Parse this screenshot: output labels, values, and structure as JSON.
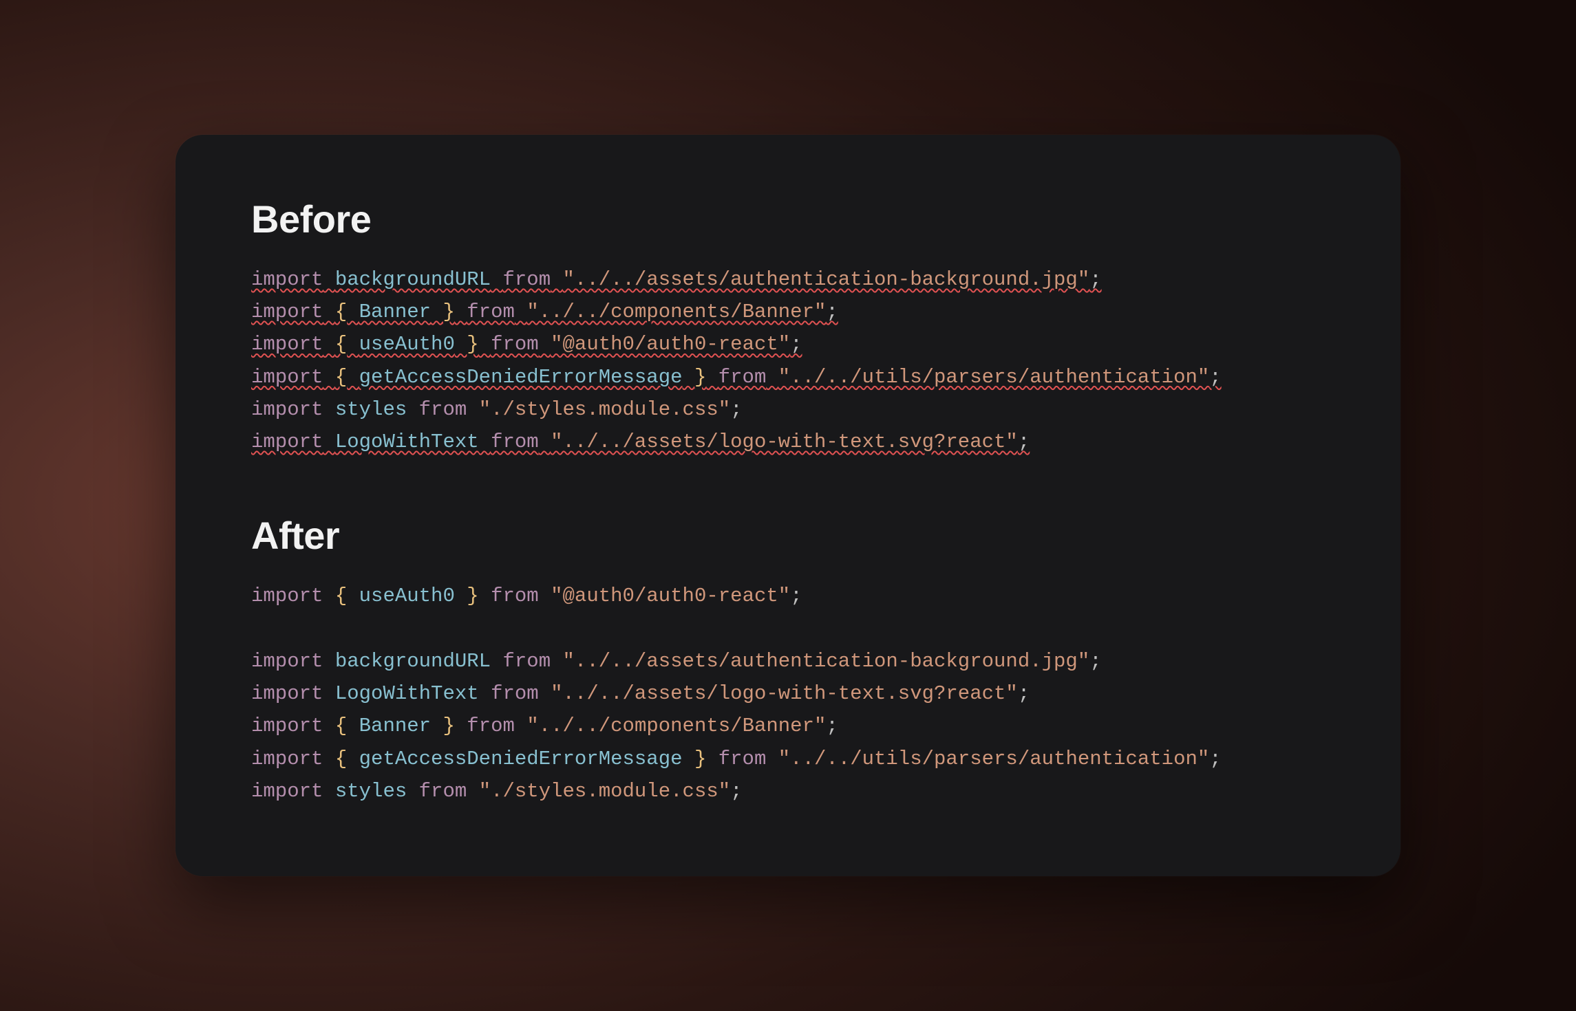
{
  "before": {
    "heading": "Before",
    "lines": [
      {
        "error": true,
        "tokens": [
          {
            "cls": "tok-kw",
            "text": "import"
          },
          {
            "cls": "tok-plain",
            "text": " "
          },
          {
            "cls": "tok-ident",
            "text": "backgroundURL"
          },
          {
            "cls": "tok-plain",
            "text": " "
          },
          {
            "cls": "tok-kw",
            "text": "from"
          },
          {
            "cls": "tok-plain",
            "text": " "
          },
          {
            "cls": "tok-str",
            "text": "\"../../assets/authentication-background.jpg\""
          },
          {
            "cls": "tok-plain",
            "text": ";"
          }
        ]
      },
      {
        "error": true,
        "tokens": [
          {
            "cls": "tok-kw",
            "text": "import"
          },
          {
            "cls": "tok-plain",
            "text": " "
          },
          {
            "cls": "tok-brace",
            "text": "{"
          },
          {
            "cls": "tok-plain",
            "text": " "
          },
          {
            "cls": "tok-ident",
            "text": "Banner"
          },
          {
            "cls": "tok-plain",
            "text": " "
          },
          {
            "cls": "tok-brace",
            "text": "}"
          },
          {
            "cls": "tok-plain",
            "text": " "
          },
          {
            "cls": "tok-kw",
            "text": "from"
          },
          {
            "cls": "tok-plain",
            "text": " "
          },
          {
            "cls": "tok-str",
            "text": "\"../../components/Banner\""
          },
          {
            "cls": "tok-plain",
            "text": ";"
          }
        ]
      },
      {
        "error": true,
        "tokens": [
          {
            "cls": "tok-kw",
            "text": "import"
          },
          {
            "cls": "tok-plain",
            "text": " "
          },
          {
            "cls": "tok-brace",
            "text": "{"
          },
          {
            "cls": "tok-plain",
            "text": " "
          },
          {
            "cls": "tok-ident",
            "text": "useAuth0"
          },
          {
            "cls": "tok-plain",
            "text": " "
          },
          {
            "cls": "tok-brace",
            "text": "}"
          },
          {
            "cls": "tok-plain",
            "text": " "
          },
          {
            "cls": "tok-kw",
            "text": "from"
          },
          {
            "cls": "tok-plain",
            "text": " "
          },
          {
            "cls": "tok-str",
            "text": "\"@auth0/auth0-react\""
          },
          {
            "cls": "tok-plain",
            "text": ";"
          }
        ]
      },
      {
        "error": true,
        "tokens": [
          {
            "cls": "tok-kw",
            "text": "import"
          },
          {
            "cls": "tok-plain",
            "text": " "
          },
          {
            "cls": "tok-brace",
            "text": "{"
          },
          {
            "cls": "tok-plain",
            "text": " "
          },
          {
            "cls": "tok-ident",
            "text": "getAccessDeniedErrorMessage"
          },
          {
            "cls": "tok-plain",
            "text": " "
          },
          {
            "cls": "tok-brace",
            "text": "}"
          },
          {
            "cls": "tok-plain",
            "text": " "
          },
          {
            "cls": "tok-kw",
            "text": "from"
          },
          {
            "cls": "tok-plain",
            "text": " "
          },
          {
            "cls": "tok-str",
            "text": "\"../../utils/parsers/authentication\""
          },
          {
            "cls": "tok-plain",
            "text": ";"
          }
        ]
      },
      {
        "error": false,
        "tokens": [
          {
            "cls": "tok-kw",
            "text": "import"
          },
          {
            "cls": "tok-plain",
            "text": " "
          },
          {
            "cls": "tok-ident",
            "text": "styles"
          },
          {
            "cls": "tok-plain",
            "text": " "
          },
          {
            "cls": "tok-kw",
            "text": "from"
          },
          {
            "cls": "tok-plain",
            "text": " "
          },
          {
            "cls": "tok-str",
            "text": "\"./styles.module.css\""
          },
          {
            "cls": "tok-plain",
            "text": ";"
          }
        ]
      },
      {
        "error": true,
        "tokens": [
          {
            "cls": "tok-kw",
            "text": "import"
          },
          {
            "cls": "tok-plain",
            "text": " "
          },
          {
            "cls": "tok-ident",
            "text": "LogoWithText"
          },
          {
            "cls": "tok-plain",
            "text": " "
          },
          {
            "cls": "tok-kw",
            "text": "from"
          },
          {
            "cls": "tok-plain",
            "text": " "
          },
          {
            "cls": "tok-str",
            "text": "\"../../assets/logo-with-text.svg?react\""
          },
          {
            "cls": "tok-plain",
            "text": ";"
          }
        ]
      }
    ]
  },
  "after": {
    "heading": "After",
    "lines": [
      {
        "error": false,
        "tokens": [
          {
            "cls": "tok-kw",
            "text": "import"
          },
          {
            "cls": "tok-plain",
            "text": " "
          },
          {
            "cls": "tok-brace",
            "text": "{"
          },
          {
            "cls": "tok-plain",
            "text": " "
          },
          {
            "cls": "tok-ident",
            "text": "useAuth0"
          },
          {
            "cls": "tok-plain",
            "text": " "
          },
          {
            "cls": "tok-brace",
            "text": "}"
          },
          {
            "cls": "tok-plain",
            "text": " "
          },
          {
            "cls": "tok-kw",
            "text": "from"
          },
          {
            "cls": "tok-plain",
            "text": " "
          },
          {
            "cls": "tok-str",
            "text": "\"@auth0/auth0-react\""
          },
          {
            "cls": "tok-plain",
            "text": ";"
          }
        ]
      },
      {
        "error": false,
        "blank": true,
        "tokens": []
      },
      {
        "error": false,
        "tokens": [
          {
            "cls": "tok-kw",
            "text": "import"
          },
          {
            "cls": "tok-plain",
            "text": " "
          },
          {
            "cls": "tok-ident",
            "text": "backgroundURL"
          },
          {
            "cls": "tok-plain",
            "text": " "
          },
          {
            "cls": "tok-kw",
            "text": "from"
          },
          {
            "cls": "tok-plain",
            "text": " "
          },
          {
            "cls": "tok-str",
            "text": "\"../../assets/authentication-background.jpg\""
          },
          {
            "cls": "tok-plain",
            "text": ";"
          }
        ]
      },
      {
        "error": false,
        "tokens": [
          {
            "cls": "tok-kw",
            "text": "import"
          },
          {
            "cls": "tok-plain",
            "text": " "
          },
          {
            "cls": "tok-ident",
            "text": "LogoWithText"
          },
          {
            "cls": "tok-plain",
            "text": " "
          },
          {
            "cls": "tok-kw",
            "text": "from"
          },
          {
            "cls": "tok-plain",
            "text": " "
          },
          {
            "cls": "tok-str",
            "text": "\"../../assets/logo-with-text.svg?react\""
          },
          {
            "cls": "tok-plain",
            "text": ";"
          }
        ]
      },
      {
        "error": false,
        "tokens": [
          {
            "cls": "tok-kw",
            "text": "import"
          },
          {
            "cls": "tok-plain",
            "text": " "
          },
          {
            "cls": "tok-brace",
            "text": "{"
          },
          {
            "cls": "tok-plain",
            "text": " "
          },
          {
            "cls": "tok-ident",
            "text": "Banner"
          },
          {
            "cls": "tok-plain",
            "text": " "
          },
          {
            "cls": "tok-brace",
            "text": "}"
          },
          {
            "cls": "tok-plain",
            "text": " "
          },
          {
            "cls": "tok-kw",
            "text": "from"
          },
          {
            "cls": "tok-plain",
            "text": " "
          },
          {
            "cls": "tok-str",
            "text": "\"../../components/Banner\""
          },
          {
            "cls": "tok-plain",
            "text": ";"
          }
        ]
      },
      {
        "error": false,
        "tokens": [
          {
            "cls": "tok-kw",
            "text": "import"
          },
          {
            "cls": "tok-plain",
            "text": " "
          },
          {
            "cls": "tok-brace",
            "text": "{"
          },
          {
            "cls": "tok-plain",
            "text": " "
          },
          {
            "cls": "tok-ident",
            "text": "getAccessDeniedErrorMessage"
          },
          {
            "cls": "tok-plain",
            "text": " "
          },
          {
            "cls": "tok-brace",
            "text": "}"
          },
          {
            "cls": "tok-plain",
            "text": " "
          },
          {
            "cls": "tok-kw",
            "text": "from"
          },
          {
            "cls": "tok-plain",
            "text": " "
          },
          {
            "cls": "tok-str",
            "text": "\"../../utils/parsers/authentication\""
          },
          {
            "cls": "tok-plain",
            "text": ";"
          }
        ]
      },
      {
        "error": false,
        "tokens": [
          {
            "cls": "tok-kw",
            "text": "import"
          },
          {
            "cls": "tok-plain",
            "text": " "
          },
          {
            "cls": "tok-ident",
            "text": "styles"
          },
          {
            "cls": "tok-plain",
            "text": " "
          },
          {
            "cls": "tok-kw",
            "text": "from"
          },
          {
            "cls": "tok-plain",
            "text": " "
          },
          {
            "cls": "tok-str",
            "text": "\"./styles.module.css\""
          },
          {
            "cls": "tok-plain",
            "text": ";"
          }
        ]
      }
    ]
  }
}
